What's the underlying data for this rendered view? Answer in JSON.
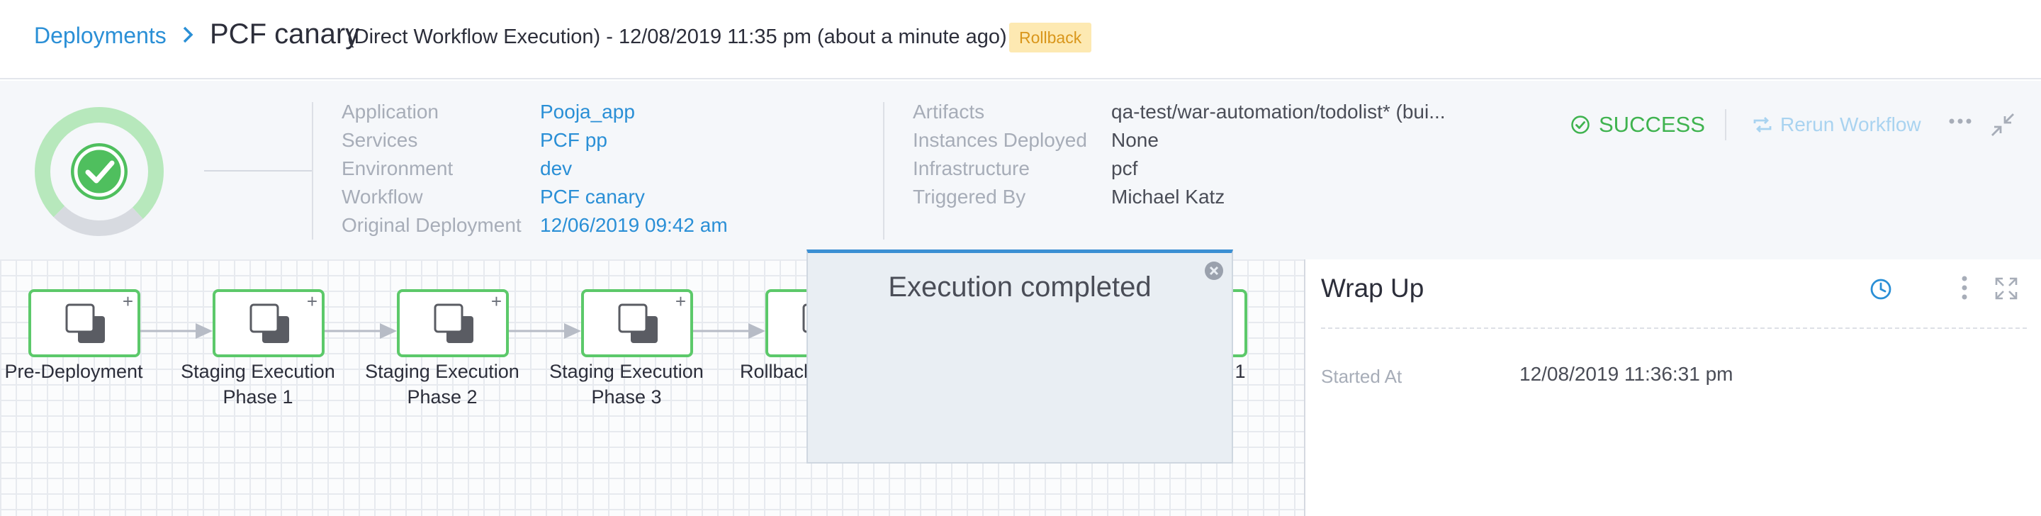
{
  "breadcrumb": {
    "link": "Deployments"
  },
  "header": {
    "title": "PCF canary",
    "subtitle": "(Direct Workflow Execution) - 12/08/2019 11:35 pm (about a minute ago)",
    "badge": "Rollback"
  },
  "summary": {
    "left": [
      {
        "key": "Application",
        "value": "Pooja_app"
      },
      {
        "key": "Services",
        "value": "PCF pp"
      },
      {
        "key": "Environment",
        "value": "dev"
      },
      {
        "key": "Workflow",
        "value": "PCF canary"
      },
      {
        "key": "Original Deployment",
        "value": "12/06/2019 09:42 am"
      }
    ],
    "right": [
      {
        "key": "Artifacts",
        "value": "qa-test/war-automation/todolist* (bui..."
      },
      {
        "key": "Instances Deployed",
        "value": "None"
      },
      {
        "key": "Infrastructure",
        "value": "pcf"
      },
      {
        "key": "Triggered By",
        "value": "Michael Katz"
      }
    ],
    "status": "SUCCESS",
    "rerun_label": "Rerun Workflow"
  },
  "pipeline": {
    "nodes": [
      {
        "label": "Pre-Deployment"
      },
      {
        "label": "Staging Execution\nPhase 1"
      },
      {
        "label": "Staging Execution\nPhase 2"
      },
      {
        "label": "Staging Execution\nPhase 3"
      },
      {
        "label": "Rollback"
      },
      {
        "label": "1"
      }
    ]
  },
  "popup": {
    "title": "Execution completed"
  },
  "details": {
    "title": "Wrap Up",
    "started_label": "Started At",
    "started_value": "12/08/2019 11:36:31 pm"
  },
  "colors": {
    "accent": "#2a8fd6",
    "success": "#3fb34f",
    "node_border": "#5cc96a",
    "badge_bg": "#fde9b2",
    "badge_fg": "#d9961b"
  }
}
